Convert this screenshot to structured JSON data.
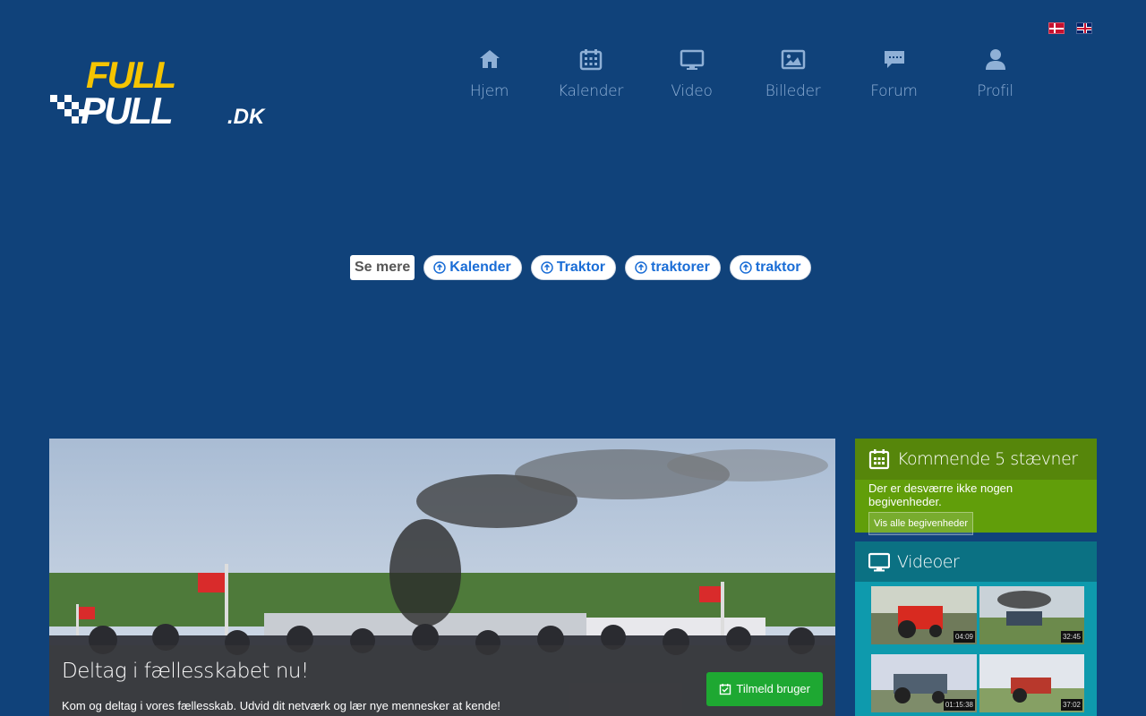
{
  "header": {
    "logo_alt": "FULLPULL.DK",
    "languages": [
      {
        "code": "da",
        "name": "Dansk"
      },
      {
        "code": "en",
        "name": "English"
      }
    ]
  },
  "nav": {
    "items": [
      {
        "label": "Hjem",
        "icon": "home-icon"
      },
      {
        "label": "Kalender",
        "icon": "calendar-icon"
      },
      {
        "label": "Video",
        "icon": "monitor-icon"
      },
      {
        "label": "Billeder",
        "icon": "image-icon"
      },
      {
        "label": "Forum",
        "icon": "chat-icon"
      },
      {
        "label": "Profil",
        "icon": "user-icon"
      }
    ]
  },
  "ad_chips": {
    "label": "Se mere",
    "items": [
      "Kalender",
      "Traktor",
      "traktorer",
      "traktor"
    ]
  },
  "hero": {
    "title": "Deltag i fællesskabet nu!",
    "subtitle": "Kom og deltag i vores fællesskab. Udvid dit netværk og lær nye mennesker at kende!",
    "button_label": "Tilmeld bruger"
  },
  "events_panel": {
    "title": "Kommende 5 stævner",
    "empty_text": "Der er desværre ikke nogen begivenheder.",
    "button_label": "Vis alle begivenheder"
  },
  "videos_panel": {
    "title": "Videoer",
    "videos": [
      {
        "duration": "04:09"
      },
      {
        "duration": "32:45"
      },
      {
        "duration": "01:15:38"
      },
      {
        "duration": "37:02"
      }
    ]
  },
  "colors": {
    "background": "#10427a",
    "events_panel": "#619e0a",
    "videos_panel": "#0e9aad",
    "signup_button": "#1ea832",
    "logo_yellow": "#f5c400"
  }
}
